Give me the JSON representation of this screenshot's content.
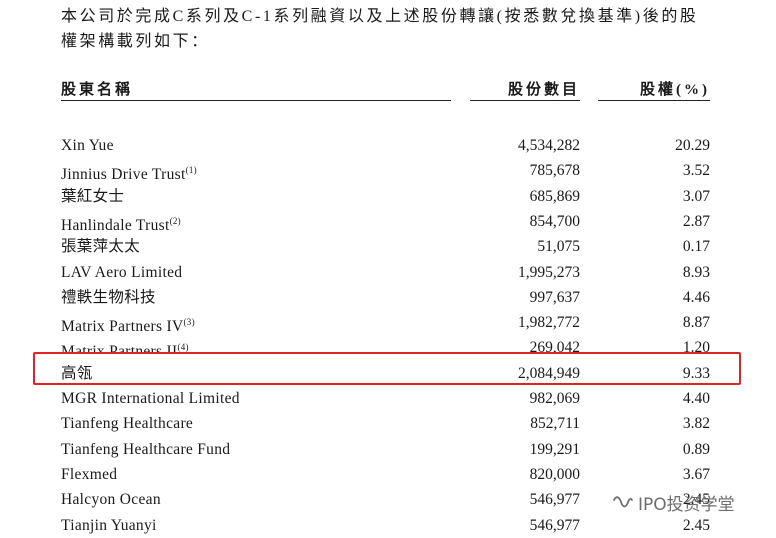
{
  "intro": {
    "line1": "本公司於完成C系列及C-1系列融資以及上述股份轉讓(按悉數兌換基準)後的股",
    "line2": "權架構載列如下："
  },
  "headers": {
    "name": "股東名稱",
    "shares": "股份數目",
    "pct": "股權(%)"
  },
  "rows": [
    {
      "name": "Xin Yue",
      "note": "",
      "shares": "4,534,282",
      "pct": "20.29"
    },
    {
      "name": "Jinnius Drive Trust",
      "note": "(1)",
      "shares": "785,678",
      "pct": "3.52"
    },
    {
      "name": "葉紅女士",
      "note": "",
      "shares": "685,869",
      "pct": "3.07"
    },
    {
      "name": "Hanlindale Trust",
      "note": "(2)",
      "shares": "854,700",
      "pct": "2.87"
    },
    {
      "name": "張葉萍太太",
      "note": "",
      "shares": "51,075",
      "pct": "0.17"
    },
    {
      "name": "LAV Aero Limited",
      "note": "",
      "shares": "1,995,273",
      "pct": "8.93"
    },
    {
      "name": "禮軼生物科技",
      "note": "",
      "shares": "997,637",
      "pct": "4.46"
    },
    {
      "name": "Matrix Partners IV",
      "note": "(3)",
      "shares": "1,982,772",
      "pct": "8.87"
    },
    {
      "name": "Matrix Partners II",
      "note": "(4)",
      "shares": "269,042",
      "pct": "1.20"
    },
    {
      "name": "高瓴",
      "note": "",
      "shares": "2,084,949",
      "pct": "9.33"
    },
    {
      "name": "MGR International Limited",
      "note": "",
      "shares": "982,069",
      "pct": "4.40"
    },
    {
      "name": "Tianfeng Healthcare",
      "note": "",
      "shares": "852,711",
      "pct": "3.82"
    },
    {
      "name": "Tianfeng Healthcare Fund",
      "note": "",
      "shares": "199,291",
      "pct": "0.89"
    },
    {
      "name": "Flexmed",
      "note": "",
      "shares": "820,000",
      "pct": "3.67"
    },
    {
      "name": "Halcyon Ocean",
      "note": "",
      "shares": "546,977",
      "pct": "2.45"
    },
    {
      "name": "Tianjin Yuanyi",
      "note": "",
      "shares": "546,977",
      "pct": "2.45"
    }
  ],
  "watermark": {
    "text": "IPO投资学堂",
    "icon": "wechat-channel-icon"
  },
  "colors": {
    "highlight": "#e02424",
    "text": "#1a1a1a"
  }
}
